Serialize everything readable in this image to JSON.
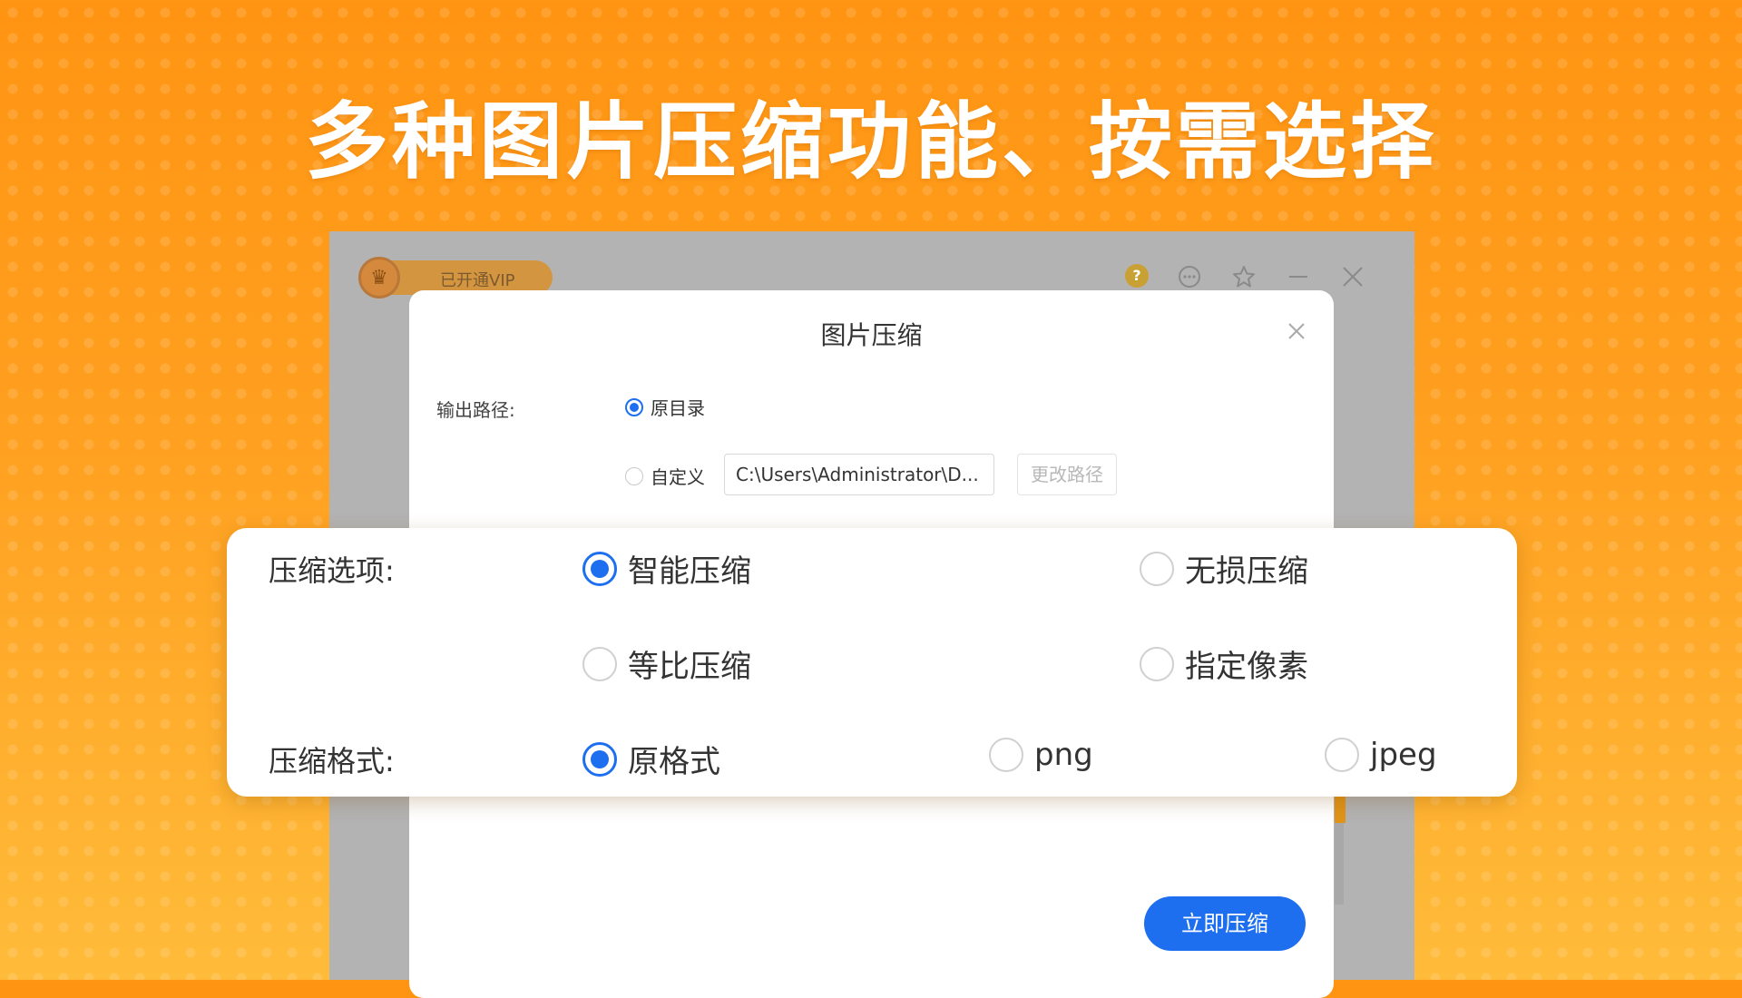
{
  "headline": "多种图片压缩功能、按需选择",
  "app": {
    "vip_label": "已开通VIP",
    "help_icon": "?",
    "controls": [
      "chat-icon",
      "star-icon",
      "minimize-icon",
      "close-icon"
    ]
  },
  "dialog": {
    "title": "图片压缩",
    "output_path_label": "输出路径:",
    "output_options": [
      {
        "label": "原目录",
        "checked": true
      },
      {
        "label": "自定义",
        "checked": false
      }
    ],
    "custom_path_value": "C:\\Users\\Administrator\\D...",
    "change_path_label": "更改路径",
    "compress_button": "立即压缩"
  },
  "options_card": {
    "compress_option_label": "压缩选项:",
    "compress_options": [
      {
        "label": "智能压缩",
        "checked": true
      },
      {
        "label": "无损压缩",
        "checked": false
      },
      {
        "label": "等比压缩",
        "checked": false
      },
      {
        "label": "指定像素",
        "checked": false
      }
    ],
    "format_label": "压缩格式:",
    "formats": [
      {
        "label": "原格式",
        "checked": true
      },
      {
        "label": "png",
        "checked": false
      },
      {
        "label": "jpeg",
        "checked": false
      }
    ]
  },
  "colors": {
    "accent_blue": "#1e6ff0",
    "background_orange": "#ff9a18",
    "vip_gold": "#d49540"
  }
}
